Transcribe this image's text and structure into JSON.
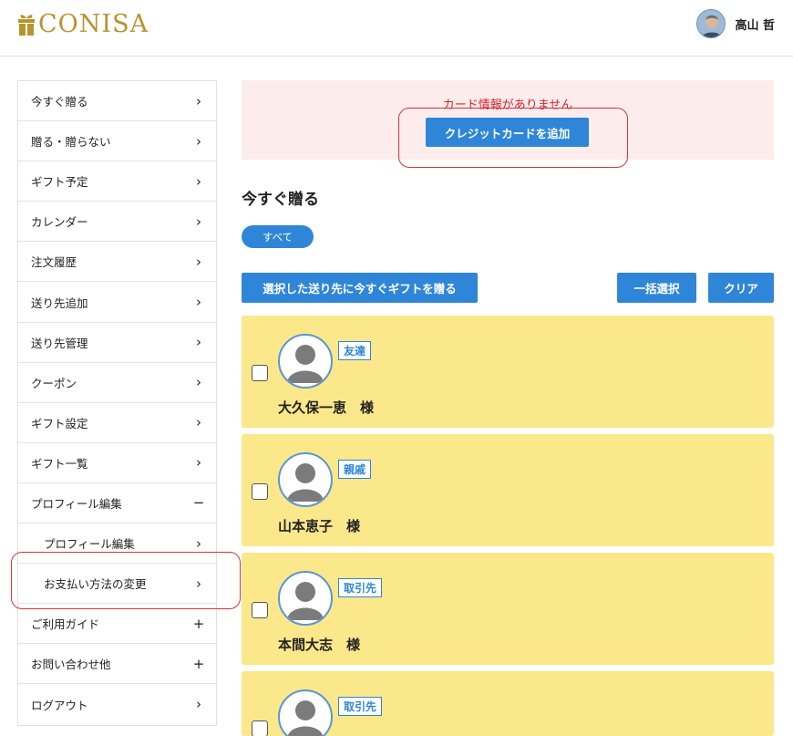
{
  "header": {
    "logo_text": "CONISA",
    "user_name": "高山 哲"
  },
  "sidebar": {
    "items": [
      {
        "label": "今すぐ贈る",
        "mark": "›"
      },
      {
        "label": "贈る・贈らない",
        "mark": "›"
      },
      {
        "label": "ギフト予定",
        "mark": "›"
      },
      {
        "label": "カレンダー",
        "mark": "›"
      },
      {
        "label": "注文履歴",
        "mark": "›"
      },
      {
        "label": "送り先追加",
        "mark": "›"
      },
      {
        "label": "送り先管理",
        "mark": "›"
      },
      {
        "label": "クーポン",
        "mark": "›"
      },
      {
        "label": "ギフト設定",
        "mark": "›"
      },
      {
        "label": "ギフト一覧",
        "mark": "›"
      },
      {
        "label": "プロフィール編集",
        "mark": "−"
      },
      {
        "label": "プロフィール編集",
        "mark": "›"
      },
      {
        "label": "お支払い方法の変更",
        "mark": "›"
      },
      {
        "label": "ご利用ガイド",
        "mark": "+"
      },
      {
        "label": "お問い合わせ他",
        "mark": "+"
      },
      {
        "label": "ログアウト",
        "mark": "›"
      }
    ]
  },
  "alert": {
    "message": "カード情報がありません",
    "button_label": "クレジットカードを追加"
  },
  "main": {
    "title": "今すぐ贈る",
    "filter_pill": "すべて",
    "send_button": "選択した送り先に今すぐギフトを贈る",
    "select_all_button": "一括選択",
    "clear_button": "クリア"
  },
  "recipients": [
    {
      "tag": "友達",
      "name": "大久保一恵　様"
    },
    {
      "tag": "親戚",
      "name": "山本恵子　様"
    },
    {
      "tag": "取引先",
      "name": "本間大志　様"
    },
    {
      "tag": "取引先",
      "name": ""
    }
  ],
  "colors": {
    "accent": "#2f86d8",
    "logo_gold": "#b8942f",
    "card_yellow": "#fbe88a",
    "alert_bg": "#fdecec",
    "alert_text": "#d0262a",
    "highlight": "#d8343a"
  }
}
